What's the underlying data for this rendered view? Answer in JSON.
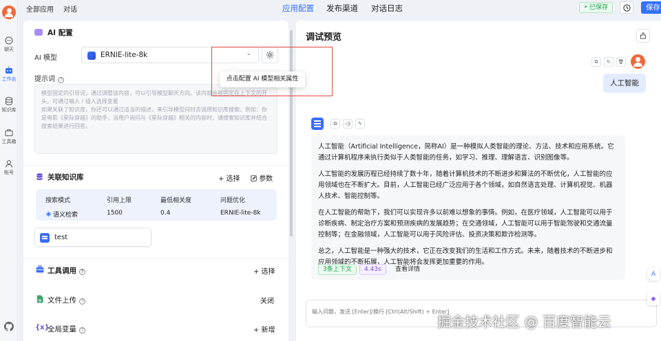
{
  "nav": {
    "items": [
      {
        "label": "聊天"
      },
      {
        "label": "工作台"
      },
      {
        "label": "知识库"
      },
      {
        "label": "工具箱"
      },
      {
        "label": "账号"
      }
    ]
  },
  "topbar": {
    "breadcrumb_all": "全部应用",
    "breadcrumb_current": "对话",
    "tabs": [
      {
        "label": "应用配置",
        "active": true
      },
      {
        "label": "发布渠道"
      },
      {
        "label": "对话日志"
      }
    ],
    "saved_status": "• 已保存",
    "save_label": "保存"
  },
  "config": {
    "ai_section_title": "AI 配置",
    "model_label": "AI 模型",
    "model_value": "ERNIE-lite-8k",
    "tooltip": "点击配置 AI 模型相关属性",
    "prompt_label": "提示词",
    "prompt_placeholder_1": "模型固定的引导词，通过调整该内容，可以引导模型聊天方向。该内容会被固定在上下文的开头。可通过输入 / 插入选择变量",
    "prompt_placeholder_2": "如果关联了知识库，你还可以通过适当的描述，来引导模型何时去调用知识库搜索。例如：你是电影《星际穿越》的助手，当用户询问与《星际穿越》相关的内容时，请搜索知识库并结合搜索结果进行回答。",
    "kb_title": "关联知识库",
    "kb_select": "+ 选择",
    "kb_params": "参数",
    "kb_table": {
      "headers": [
        "搜索模式",
        "引用上限",
        "最低相关度",
        "问题优化"
      ],
      "values": [
        "语义检索",
        "1500",
        "0.4",
        "ERNIE-lite-8k"
      ]
    },
    "kb_file": "test",
    "tools_title": "工具调用",
    "tools_select": "+ 选择",
    "upload_title": "文件上传",
    "upload_value": "关闭",
    "vars_title": "全局变量",
    "vars_add": "+ 新增"
  },
  "preview": {
    "title": "调试预览",
    "user_message": "人工智能",
    "ai_paragraphs": [
      "人工智能（Artificial Intelligence，简称AI）是一种模拟人类智能的理论、方法、技术和应用系统。它通过计算机程序来执行类似于人类智能的任务，如学习、推理、理解语言、识别图像等。",
      "人工智能的发展历程已经持续了数十年，随着计算机技术的不断进步和算法的不断优化，人工智能的应用领域也在不断扩大。目前，人工智能已经广泛应用于各个领域，如自然语言处理、计算机视觉、机器人技术、智能控制等。",
      "在人工智能的帮助下，我们可以实现许多以前难以想象的事情。例如，在医疗领域，人工智能可以用于诊断疾病、制定治疗方案和预测疾病的发展趋势；在交通领域，人工智能可以用于智能驾驶和交通流量控制等；在金融领域，人工智能可以用于风险评估、投资决策和欺诈检测等。",
      "总之，人工智能是一种强大的技术，它正在改变我们的生活和工作方式。未来，随着技术的不断进步和应用领域的不断拓展，人工智能将会发挥更加重要的作用。"
    ],
    "context_tag": "3条上下文",
    "time_tag": "4.43s",
    "detail_link": "查看详情",
    "input_placeholder": "输入问题，发送 [Enter]/换行 [Ctrl(Alt/Shift) + Enter]"
  },
  "watermark": "掘金技术社区 @ 百度智能云",
  "colors": {
    "accent": "#3370ff",
    "saved": "#1aa34a",
    "highlight_box": "#e8453c",
    "user_bubble": "#e3ecff"
  }
}
